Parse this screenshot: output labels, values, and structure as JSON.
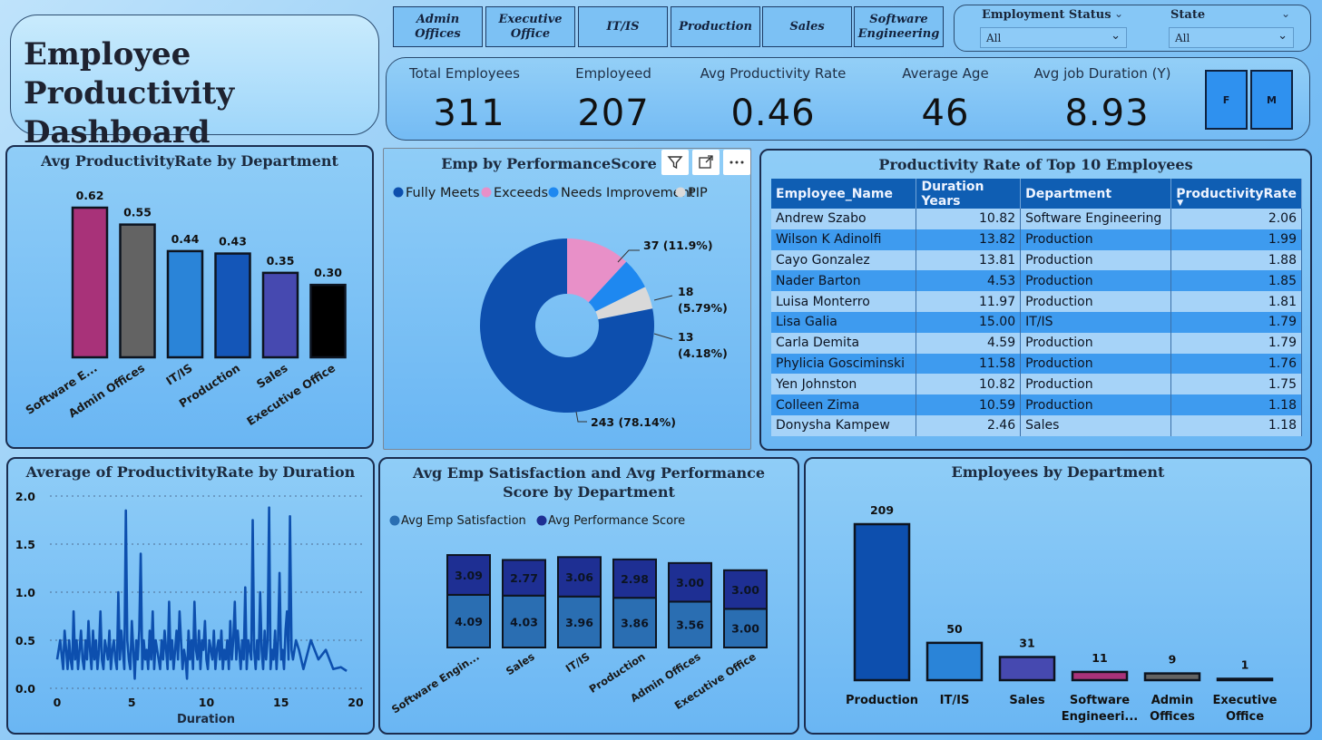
{
  "title": "Employee Productivity Dashboard",
  "slicer_departments": [
    "Admin Offices",
    "Executive Office",
    "IT/IS",
    "Production",
    "Sales",
    "Software Engineering"
  ],
  "filters": {
    "employment_status": {
      "label": "Employment Status",
      "value": "All"
    },
    "state": {
      "label": "State",
      "value": "All"
    }
  },
  "kpis": [
    {
      "label": "Total Employees",
      "value": "311"
    },
    {
      "label": "Employeed",
      "value": "207"
    },
    {
      "label": "Avg Productivity Rate",
      "value": "0.46"
    },
    {
      "label": "Average Age",
      "value": "46"
    },
    {
      "label": "Avg job Duration (Y)",
      "value": "8.93"
    }
  ],
  "gender_buttons": [
    "F",
    "M"
  ],
  "colors": {
    "navy": "#0d4fae",
    "blue": "#2781d6",
    "pink": "#e890c8",
    "grey": "#d9d9d9",
    "bright": "#1e88f0"
  },
  "chart_data": [
    {
      "type": "bar",
      "title": "Avg ProductivityRate by Department",
      "categories": [
        "Software E...",
        "Admin Offices",
        "IT/IS",
        "Production",
        "Sales",
        "Executive Office"
      ],
      "values": [
        0.62,
        0.55,
        0.44,
        0.43,
        0.35,
        0.3
      ],
      "value_labels": [
        "0.62",
        "0.55",
        "0.44",
        "0.43",
        "0.35",
        "0.30"
      ],
      "colors": [
        "#a83279",
        "#636363",
        "#2a84d8",
        "#1456b8",
        "#4649b0",
        "#000000"
      ]
    },
    {
      "type": "pie",
      "title": "Emp by PerformanceScore",
      "legend": [
        "Fully Meets",
        "Exceeds",
        "Needs Improvement",
        "PIP"
      ],
      "values": [
        243,
        37,
        18,
        13
      ],
      "labels": [
        "243 (78.14%)",
        "37 (11.9%)",
        "18 (5.79%)",
        "13 (4.18%)"
      ],
      "colors": [
        "#0d4fae",
        "#e890c8",
        "#1e88f0",
        "#d9d9d9"
      ]
    },
    {
      "type": "table",
      "title": "Productivity Rate of Top 10 Employees",
      "columns": [
        "Employee_Name",
        "Duration Years",
        "Department",
        "ProductivityRate"
      ],
      "rows": [
        [
          "Andrew Szabo",
          "10.82",
          "Software Engineering",
          "2.06"
        ],
        [
          "Wilson K Adinolfi",
          "13.82",
          "Production",
          "1.99"
        ],
        [
          "Cayo Gonzalez",
          "13.81",
          "Production",
          "1.88"
        ],
        [
          "Nader Barton",
          "4.53",
          "Production",
          "1.85"
        ],
        [
          "Luisa Monterro",
          "11.97",
          "Production",
          "1.81"
        ],
        [
          "Lisa Galia",
          "15.00",
          "IT/IS",
          "1.79"
        ],
        [
          "Carla Demita",
          "4.59",
          "Production",
          "1.79"
        ],
        [
          "Phylicia Gosciminski",
          "11.58",
          "Production",
          "1.76"
        ],
        [
          "Yen Johnston",
          "10.82",
          "Production",
          "1.75"
        ],
        [
          "Colleen Zima",
          "10.59",
          "Production",
          "1.18"
        ],
        [
          "Donysha Kampew",
          "2.46",
          "Sales",
          "1.18"
        ]
      ]
    },
    {
      "type": "line",
      "title": "Average of ProductivityRate by Duration",
      "xlabel": "Duration",
      "xlim": [
        0,
        20
      ],
      "ylim": [
        0,
        2.0
      ],
      "xticks": [
        "0",
        "5",
        "10",
        "15",
        "20"
      ],
      "yticks": [
        "0.0",
        "0.5",
        "1.0",
        "1.5",
        "2.0"
      ],
      "x": [
        0.0,
        0.2,
        0.4,
        0.5,
        0.6,
        0.7,
        0.8,
        0.9,
        1.0,
        1.1,
        1.2,
        1.3,
        1.4,
        1.5,
        1.6,
        1.7,
        1.8,
        1.9,
        2.0,
        2.1,
        2.2,
        2.3,
        2.4,
        2.5,
        2.6,
        2.7,
        2.8,
        2.9,
        3.0,
        3.1,
        3.2,
        3.3,
        3.4,
        3.5,
        3.6,
        3.7,
        3.8,
        3.9,
        4.0,
        4.1,
        4.2,
        4.3,
        4.4,
        4.5,
        4.6,
        4.7,
        4.8,
        4.9,
        5.0,
        5.1,
        5.2,
        5.3,
        5.4,
        5.5,
        5.6,
        5.7,
        5.8,
        5.9,
        6.0,
        6.1,
        6.2,
        6.3,
        6.4,
        6.5,
        6.6,
        6.7,
        6.8,
        6.9,
        7.0,
        7.1,
        7.2,
        7.3,
        7.4,
        7.5,
        7.6,
        7.7,
        7.8,
        7.9,
        8.0,
        8.1,
        8.2,
        8.3,
        8.4,
        8.5,
        8.6,
        8.7,
        8.8,
        8.9,
        9.0,
        9.1,
        9.2,
        9.3,
        9.4,
        9.5,
        9.6,
        9.7,
        9.8,
        9.9,
        10.0,
        10.1,
        10.2,
        10.3,
        10.4,
        10.5,
        10.6,
        10.7,
        10.8,
        10.9,
        11.0,
        11.1,
        11.2,
        11.3,
        11.4,
        11.5,
        11.6,
        11.7,
        11.8,
        11.9,
        12.0,
        12.1,
        12.2,
        12.3,
        12.4,
        12.5,
        12.6,
        12.7,
        12.8,
        12.9,
        13.0,
        13.1,
        13.2,
        13.3,
        13.4,
        13.5,
        13.6,
        13.7,
        13.8,
        13.9,
        14.0,
        14.1,
        14.2,
        14.3,
        14.4,
        14.5,
        14.6,
        14.7,
        14.8,
        14.9,
        15.0,
        15.1,
        15.2,
        15.3,
        15.4,
        15.5,
        15.6,
        15.7,
        15.8,
        16.0,
        16.2,
        16.5,
        17.0,
        17.5,
        18.0,
        18.5,
        19.0,
        19.4
      ],
      "values": [
        0.3,
        0.5,
        0.2,
        0.6,
        0.4,
        0.2,
        0.5,
        0.3,
        0.2,
        0.8,
        0.3,
        0.5,
        0.2,
        0.4,
        0.6,
        0.3,
        0.2,
        0.5,
        0.3,
        0.7,
        0.4,
        0.2,
        0.6,
        0.3,
        0.5,
        0.2,
        0.4,
        0.8,
        0.3,
        0.2,
        0.5,
        0.4,
        0.3,
        0.6,
        0.2,
        0.4,
        0.5,
        0.3,
        0.2,
        1.0,
        0.3,
        0.6,
        0.4,
        0.2,
        1.85,
        0.5,
        0.3,
        0.2,
        0.7,
        0.4,
        0.1,
        0.5,
        0.3,
        0.6,
        1.4,
        0.2,
        0.5,
        0.3,
        0.4,
        0.2,
        0.6,
        0.3,
        0.8,
        0.2,
        0.5,
        0.4,
        0.3,
        0.2,
        0.5,
        0.3,
        0.6,
        0.4,
        0.2,
        0.9,
        0.3,
        0.5,
        0.2,
        0.4,
        0.6,
        0.3,
        0.8,
        0.5,
        0.2,
        0.4,
        0.3,
        0.1,
        0.6,
        0.3,
        0.5,
        0.2,
        0.9,
        0.4,
        0.3,
        0.6,
        0.2,
        0.5,
        0.4,
        0.7,
        0.3,
        0.2,
        0.5,
        0.4,
        0.3,
        0.6,
        0.2,
        0.4,
        0.5,
        0.3,
        0.6,
        0.2,
        0.4,
        0.3,
        0.5,
        0.2,
        0.7,
        0.3,
        0.5,
        0.9,
        0.3,
        0.6,
        0.4,
        0.2,
        0.5,
        0.3,
        1.05,
        0.2,
        0.5,
        0.4,
        0.3,
        1.75,
        0.4,
        0.2,
        0.5,
        0.3,
        1.0,
        0.4,
        0.2,
        0.6,
        0.3,
        0.5,
        1.88,
        0.2,
        0.4,
        0.3,
        0.6,
        0.2,
        0.5,
        1.2,
        0.3,
        0.4,
        0.2,
        0.6,
        0.8,
        0.3,
        1.79,
        0.4,
        0.3,
        0.5,
        0.4,
        0.2,
        0.5,
        0.3,
        0.4,
        0.2,
        0.22,
        0.18,
        0.3,
        0.5
      ]
    },
    {
      "type": "bar",
      "title": "Avg Emp Satisfaction and Avg Performance Score by Department",
      "categories": [
        "Software Engin...",
        "Sales",
        "IT/IS",
        "Production",
        "Admin Offices",
        "Executive Office"
      ],
      "series": [
        {
          "name": "Avg Emp Satisfaction",
          "values": [
            4.09,
            4.03,
            3.96,
            3.86,
            3.56,
            3.0
          ],
          "labels": [
            "4.09",
            "4.03",
            "3.96",
            "3.86",
            "3.56",
            "3.00"
          ]
        },
        {
          "name": "Avg Performance Score",
          "values": [
            3.09,
            2.77,
            3.06,
            2.98,
            3.0,
            3.0
          ],
          "labels": [
            "3.09",
            "2.77",
            "3.06",
            "2.98",
            "3.00",
            "3.00"
          ]
        }
      ],
      "colors": [
        "#2a6eb2",
        "#1e2f93"
      ]
    },
    {
      "type": "bar",
      "title": "Employees by Department",
      "categories": [
        "Production",
        "IT/IS",
        "Sales",
        "Software Engineeri...",
        "Admin Offices",
        "Executive Office"
      ],
      "values": [
        209,
        50,
        31,
        11,
        9,
        1
      ],
      "value_labels": [
        "209",
        "50",
        "31",
        "11",
        "9",
        "1"
      ],
      "colors": [
        "#0d4fae",
        "#2a84d8",
        "#4649b0",
        "#a83279",
        "#636363",
        "#000000"
      ]
    }
  ]
}
